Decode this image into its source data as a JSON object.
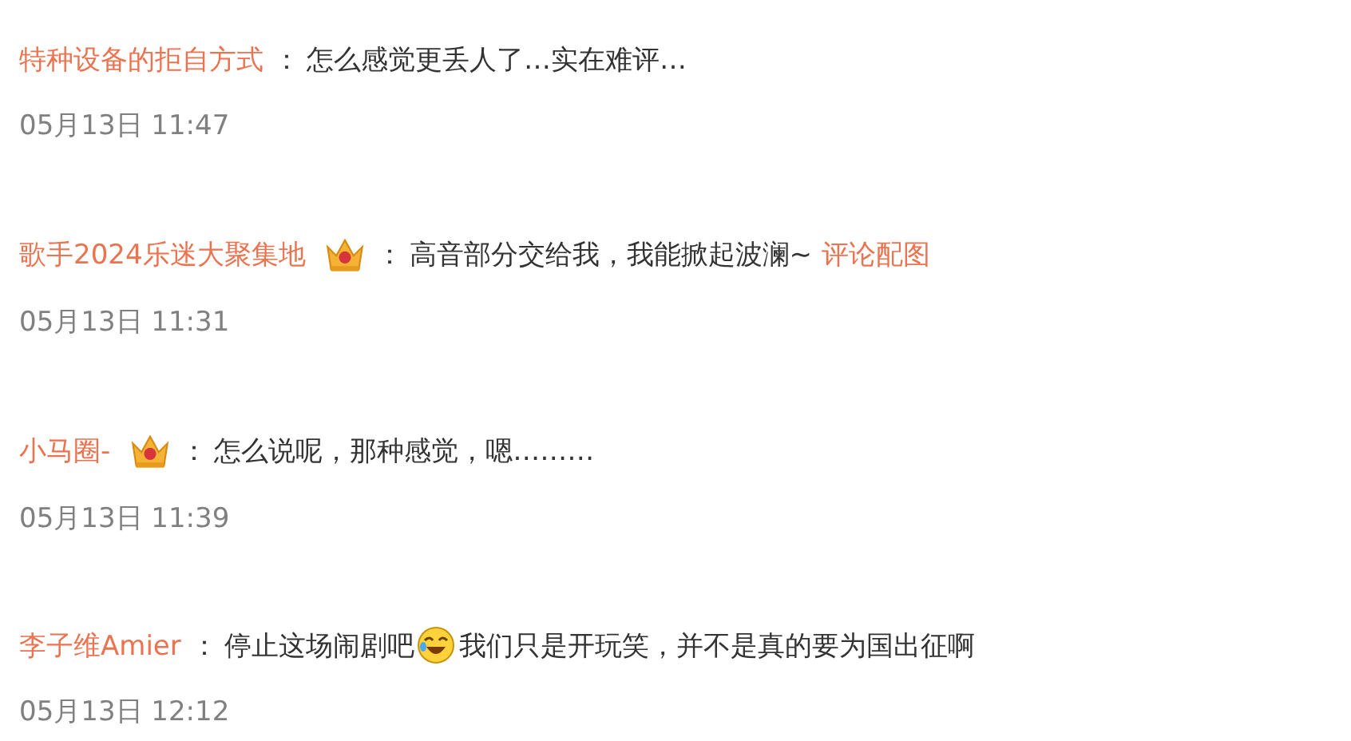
{
  "comments": [
    {
      "user": "特种设备的拒自方式",
      "badge": false,
      "separator": "：",
      "parts": [
        {
          "kind": "text",
          "text": "怎么感觉更丢人了…实在难评…"
        }
      ],
      "time": "05月13日 11:47"
    },
    {
      "user": "歌手2024乐迷大聚集地",
      "badge": true,
      "separator": "：",
      "parts": [
        {
          "kind": "text",
          "text": "高音部分交给我，我能掀起波澜~"
        },
        {
          "kind": "link",
          "text": "评论配图"
        }
      ],
      "time": "05月13日 11:31"
    },
    {
      "user": "小马圈-",
      "badge": true,
      "separator": "：",
      "parts": [
        {
          "kind": "text",
          "text": "怎么说呢，那种感觉，嗯………"
        }
      ],
      "time": "05月13日 11:39"
    },
    {
      "user": "李子维Amier",
      "badge": false,
      "separator": "：",
      "parts": [
        {
          "kind": "text",
          "text": "停止这场闹剧吧"
        },
        {
          "kind": "emoji"
        },
        {
          "kind": "text",
          "text": "我们只是开玩笑，并不是真的要为国出征啊"
        }
      ],
      "time": "05月13日 12:12"
    }
  ]
}
